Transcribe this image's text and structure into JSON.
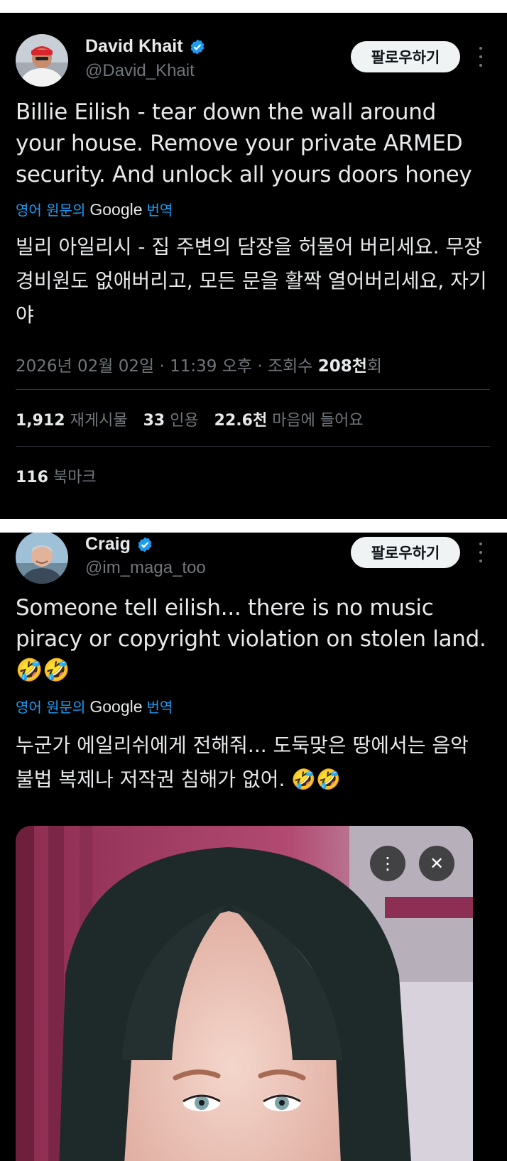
{
  "tweets": [
    {
      "display_name": "David Khait",
      "handle": "@David_Khait",
      "follow_label": "팔로우하기",
      "text": "Billie Eilish - tear down the wall around your house. Remove your private ARMED security. And unlock all yours doors honey",
      "translate_prefix": "영어 원문의",
      "translate_brand": "Google",
      "translate_suffix": "번역",
      "translated_text": "빌리 아일리시 - 집 주변의 담장을 허물어 버리세요. 무장 경비원도 없애버리고, 모든 문을 활짝 열어버리세요, 자기야",
      "timestamp": "2026년 02월 02일 · 11:39 오후 · 조회수",
      "views_count": "208천",
      "views_suffix": "회",
      "stats": {
        "retweets_count": "1,912",
        "retweets_label": "재게시물",
        "quotes_count": "33",
        "quotes_label": "인용",
        "likes_count": "22.6천",
        "likes_label": "마음에 들어요",
        "bookmarks_count": "116",
        "bookmarks_label": "북마크"
      }
    },
    {
      "display_name": "Craig",
      "handle": "@im_maga_too",
      "follow_label": "팔로우하기",
      "text": "Someone tell eilish... there is no music piracy or copyright violation on stolen land. 🤣🤣",
      "translate_prefix": "영어 원문의",
      "translate_brand": "Google",
      "translate_suffix": "번역",
      "translated_text": "누군가 에일리쉬에게 전해줘... 도둑맞은 땅에서는 음악 불법 복제나 저작권 침해가 없어. 🤣🤣",
      "media_buttons": {
        "more": "⋮",
        "close": "✕"
      }
    }
  ],
  "colors": {
    "background": "#000000",
    "text": "#e7e9ea",
    "muted": "#71767b",
    "accent": "#1d9bf0",
    "follow_bg": "#eff3f4"
  },
  "icons": [
    "verified-badge-icon",
    "more-options-icon",
    "close-icon"
  ]
}
